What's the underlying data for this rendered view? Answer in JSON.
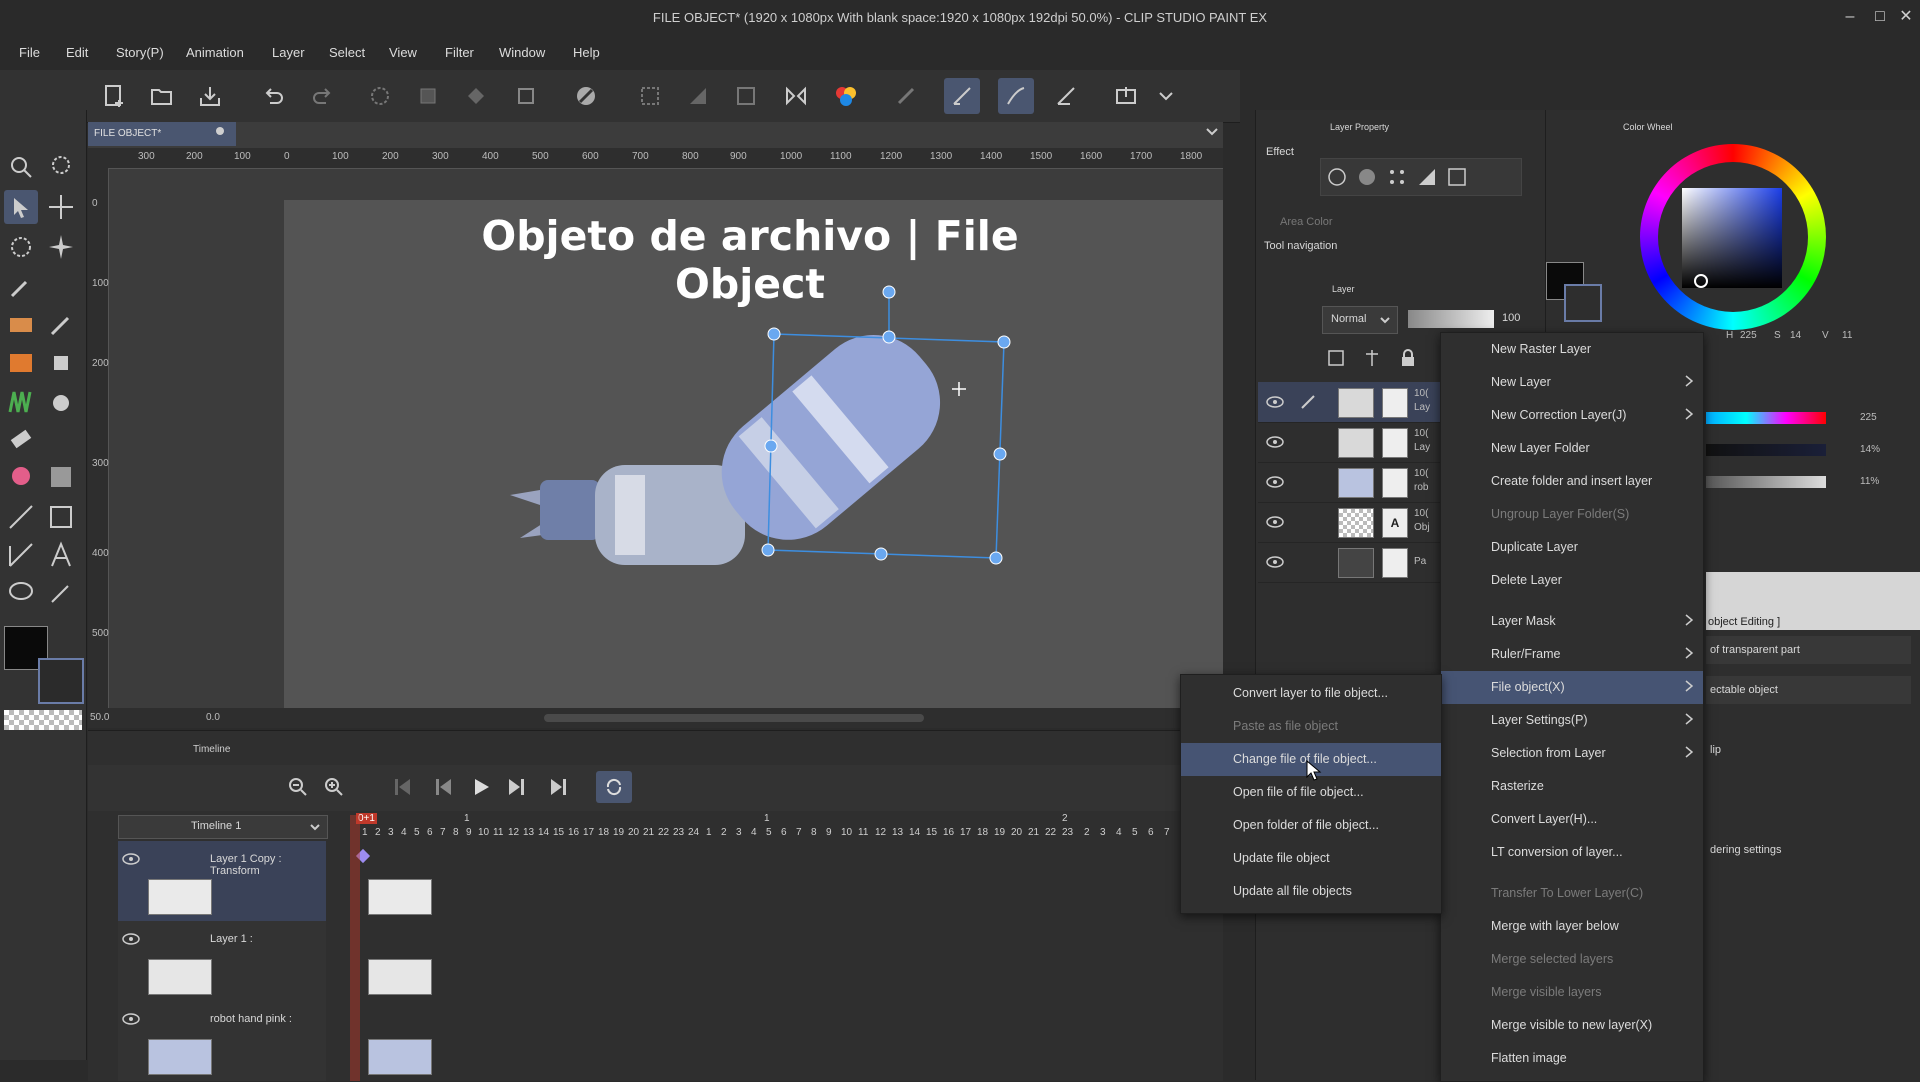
{
  "window": {
    "title": "FILE OBJECT* (1920 x 1080px With blank space:1920 x 1080px 192dpi 50.0%) - CLIP STUDIO PAINT EX"
  },
  "menu": [
    "File",
    "Edit",
    "Story(P)",
    "Animation",
    "Layer",
    "Select",
    "View",
    "Filter",
    "Window",
    "Help"
  ],
  "document_tab": {
    "label": "FILE OBJECT*"
  },
  "ruler": {
    "ticks": [
      "300",
      "200",
      "100",
      "0",
      "100",
      "200",
      "300",
      "400",
      "500",
      "600",
      "700",
      "800",
      "900",
      "1000",
      "1100",
      "1200",
      "1300",
      "1400",
      "1500",
      "1600",
      "1700",
      "1800"
    ]
  },
  "ruler_v": {
    "ticks": [
      "0",
      "100",
      "200",
      "300",
      "400",
      "500"
    ]
  },
  "canvas": {
    "title": "Objeto de archivo | File Object",
    "zoom": "50.0",
    "angle": "0.0"
  },
  "timeline": {
    "panel_label": "Timeline",
    "name": "Timeline 1",
    "frames_a": [
      "1",
      "2",
      "3",
      "4",
      "5",
      "6",
      "7",
      "8",
      "9",
      "10",
      "11",
      "12",
      "13",
      "14",
      "15",
      "16",
      "17",
      "18",
      "19",
      "20",
      "21",
      "22",
      "23",
      "24"
    ],
    "frames_b": [
      "1",
      "2",
      "3",
      "4",
      "5",
      "6",
      "7",
      "8",
      "9",
      "10",
      "11",
      "12",
      "13",
      "14",
      "15",
      "16",
      "17",
      "18",
      "19",
      "20",
      "21",
      "22",
      "23"
    ],
    "frames_c": [
      "2",
      "3",
      "4",
      "5",
      "6",
      "7"
    ],
    "playhead": "0+1",
    "layers": [
      {
        "name": "Layer 1 Copy : Transform"
      },
      {
        "name": "Layer 1 :"
      },
      {
        "name": "robot hand pink :"
      }
    ]
  },
  "layer_property": {
    "panel_label": "Layer Property",
    "effect_label": "Effect",
    "area_color_label": "Area Color",
    "tool_nav_label": "Tool navigation"
  },
  "layer_panel": {
    "panel_label": "Layer",
    "blend_mode": "Normal",
    "opacity": "100",
    "rows": [
      {
        "pct": "10(",
        "sub": "Lay"
      },
      {
        "pct": "10(",
        "sub": "Lay"
      },
      {
        "pct": "10(",
        "sub": "rob"
      },
      {
        "pct": "10(",
        "sub": "Obj"
      },
      {
        "pct": "",
        "sub": "Pa"
      }
    ]
  },
  "color_panel": {
    "panel_label": "Color Wheel",
    "h_label": "H",
    "h": "225",
    "s_label": "S",
    "s": "14",
    "v_label": "V",
    "v": "11",
    "slider1": "225",
    "slider2": "14%",
    "slider3": "11%",
    "main_color": "#0a0a0a",
    "sub_color": "#ffffff"
  },
  "partial_panel": {
    "obj_editing": "object Editing ]",
    "drop1": "of transparent part",
    "drop2": "ectable object",
    "lip": "lip",
    "rendering": "dering settings"
  },
  "context_menu": {
    "items": [
      {
        "label": "New Raster Layer",
        "submenu": false,
        "disabled": false
      },
      {
        "label": "New Layer",
        "submenu": true,
        "disabled": false
      },
      {
        "label": "New Correction Layer(J)",
        "submenu": true,
        "disabled": false
      },
      {
        "label": "New Layer Folder",
        "submenu": false,
        "disabled": false
      },
      {
        "label": "Create folder and insert layer",
        "submenu": false,
        "disabled": false
      },
      {
        "label": "Ungroup Layer Folder(S)",
        "submenu": false,
        "disabled": true
      },
      {
        "label": "Duplicate Layer",
        "submenu": false,
        "disabled": false
      },
      {
        "label": "Delete Layer",
        "submenu": false,
        "disabled": false
      },
      {
        "label": "Layer Mask",
        "submenu": true,
        "disabled": false
      },
      {
        "label": "Ruler/Frame",
        "submenu": true,
        "disabled": false
      },
      {
        "label": "File object(X)",
        "submenu": true,
        "disabled": false,
        "highlighted": true
      },
      {
        "label": "Layer Settings(P)",
        "submenu": true,
        "disabled": false
      },
      {
        "label": "Selection from Layer",
        "submenu": true,
        "disabled": false
      },
      {
        "label": "Rasterize",
        "submenu": false,
        "disabled": false
      },
      {
        "label": "Convert Layer(H)...",
        "submenu": false,
        "disabled": false
      },
      {
        "label": "LT conversion of layer...",
        "submenu": false,
        "disabled": false
      },
      {
        "label": "Transfer To Lower Layer(C)",
        "submenu": false,
        "disabled": true
      },
      {
        "label": "Merge with layer below",
        "submenu": false,
        "disabled": false
      },
      {
        "label": "Merge selected layers",
        "submenu": false,
        "disabled": true
      },
      {
        "label": "Merge visible layers",
        "submenu": false,
        "disabled": true
      },
      {
        "label": "Merge visible to new layer(X)",
        "submenu": false,
        "disabled": false
      },
      {
        "label": "Flatten image",
        "submenu": false,
        "disabled": false
      }
    ]
  },
  "file_object_submenu": {
    "items": [
      {
        "label": "Convert layer to file object...",
        "disabled": false
      },
      {
        "label": "Paste as file object",
        "disabled": true
      },
      {
        "label": "Change file of file object...",
        "disabled": false,
        "highlighted": true
      },
      {
        "label": "Open file of file object...",
        "disabled": false
      },
      {
        "label": "Open folder of file object...",
        "disabled": false
      },
      {
        "label": "Update file object",
        "disabled": false
      },
      {
        "label": "Update all file objects",
        "disabled": false
      }
    ]
  },
  "icons": [
    "new-file-icon",
    "open-file-icon",
    "save-icon",
    "undo-icon",
    "redo-icon",
    "zoom-icon",
    "move-icon",
    "eye-icon",
    "play-icon",
    "lock-icon",
    "chevron-right-icon"
  ]
}
